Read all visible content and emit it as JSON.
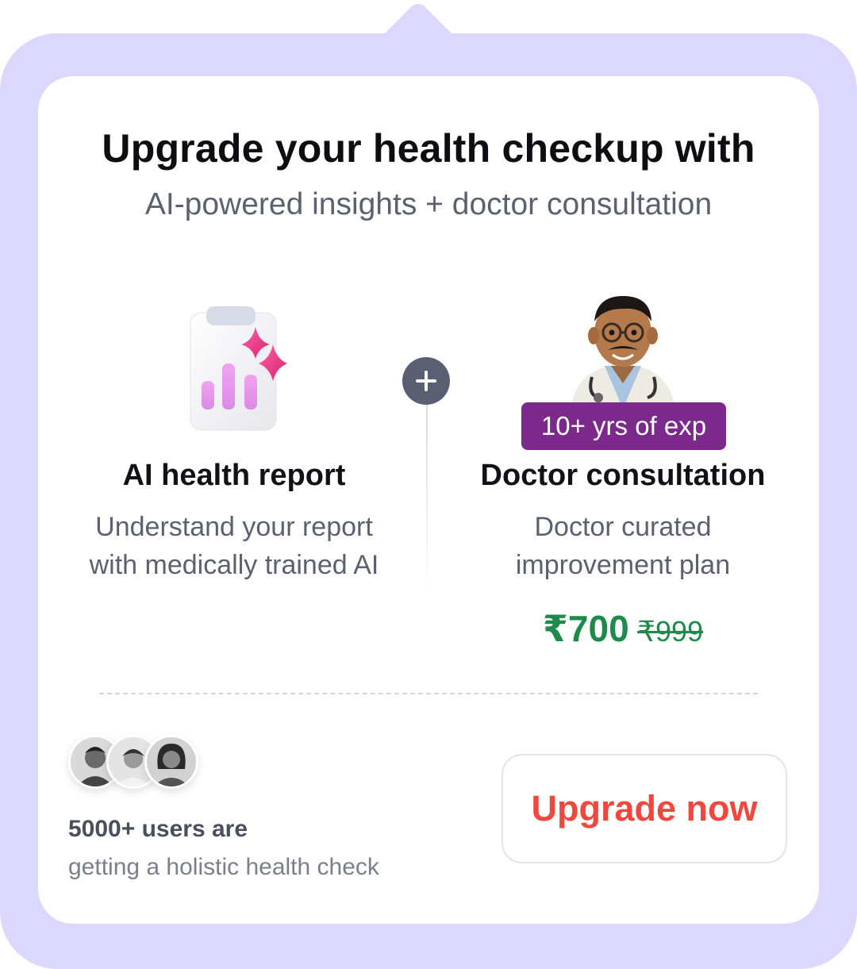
{
  "header": {
    "title": "Upgrade your health checkup with",
    "subtitle": "AI-powered insights + doctor consultation"
  },
  "features": {
    "ai_report": {
      "icon": "clipboard-chart-sparkle-icon",
      "title": "AI health report",
      "description_line1": "Understand your report",
      "description_line2": "with medically trained AI"
    },
    "doctor": {
      "icon": "doctor-avatar-icon",
      "badge": "10+ yrs of exp",
      "title": "Doctor consultation",
      "description_line1": "Doctor curated",
      "description_line2": "improvement plan",
      "price": "₹700",
      "original_price": "₹999"
    }
  },
  "social_proof": {
    "title": "5000+ users are",
    "description": "getting a holistic health check"
  },
  "cta": {
    "label": "Upgrade now"
  },
  "colors": {
    "frame": "#dcd8fd",
    "badge": "#7b2a8c",
    "price": "#1f8a4c",
    "cta_text": "#f0483f"
  }
}
